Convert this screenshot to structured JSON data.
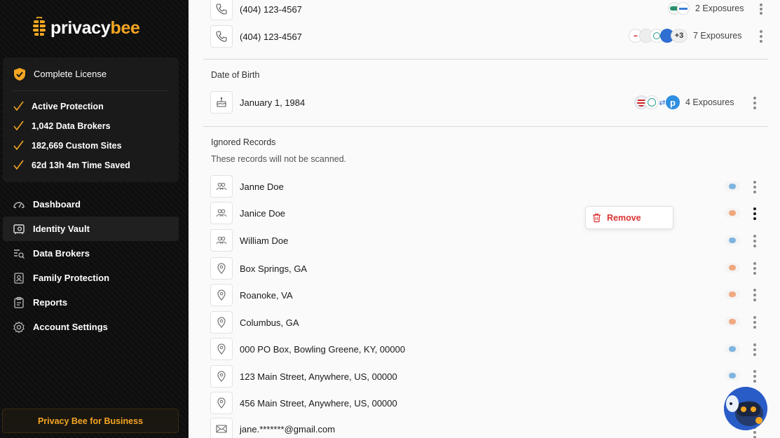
{
  "brand": {
    "name_white": "privacy",
    "name_yellow": "bee"
  },
  "license": {
    "title": "Complete License",
    "features": [
      "Active Protection",
      "1,042 Data Brokers",
      "182,669 Custom Sites",
      "62d 13h 4m Time Saved"
    ]
  },
  "nav": [
    {
      "label": "Dashboard",
      "icon": "gauge-icon",
      "active": false
    },
    {
      "label": "Identity Vault",
      "icon": "vault-icon",
      "active": true
    },
    {
      "label": "Data Brokers",
      "icon": "search-list-icon",
      "active": false
    },
    {
      "label": "Family Protection",
      "icon": "person-badge-icon",
      "active": false
    },
    {
      "label": "Reports",
      "icon": "clipboard-icon",
      "active": false
    },
    {
      "label": "Account Settings",
      "icon": "gear-icon",
      "active": false
    }
  ],
  "business_button": "Privacy Bee for Business",
  "phones": [
    {
      "value": "(404) 123-4567",
      "exposures": "2 Exposures"
    },
    {
      "value": "(404) 123-4567",
      "more": "+3",
      "exposures": "7 Exposures"
    }
  ],
  "dob": {
    "title": "Date of Birth",
    "value": "January 1, 1984",
    "exposures": "4 Exposures"
  },
  "ignored": {
    "title": "Ignored Records",
    "subtitle": "These records will not be scanned.",
    "records": [
      {
        "value": "Janne Doe",
        "icon": "people-icon"
      },
      {
        "value": "Janice Doe",
        "icon": "people-icon"
      },
      {
        "value": "William Doe",
        "icon": "people-icon"
      },
      {
        "value": "Box Springs, GA",
        "icon": "location-pin-icon"
      },
      {
        "value": "Roanoke, VA",
        "icon": "location-pin-icon"
      },
      {
        "value": "Columbus, GA",
        "icon": "location-pin-icon"
      },
      {
        "value": "000 PO Box, Bowling Greene, KY, 00000",
        "icon": "location-pin-icon"
      },
      {
        "value": "123 Main Street, Anywhere, US, 00000",
        "icon": "location-pin-icon"
      },
      {
        "value": "456 Main Street, Anywhere, US, 00000",
        "icon": "location-pin-icon"
      },
      {
        "value": "jane.*******@gmail.com",
        "icon": "mail-icon"
      }
    ]
  },
  "popover": {
    "remove_label": "Remove"
  },
  "colors": {
    "accent": "#f5a623",
    "danger": "#d33333",
    "sidebar_bg": "#0e0e0e"
  }
}
